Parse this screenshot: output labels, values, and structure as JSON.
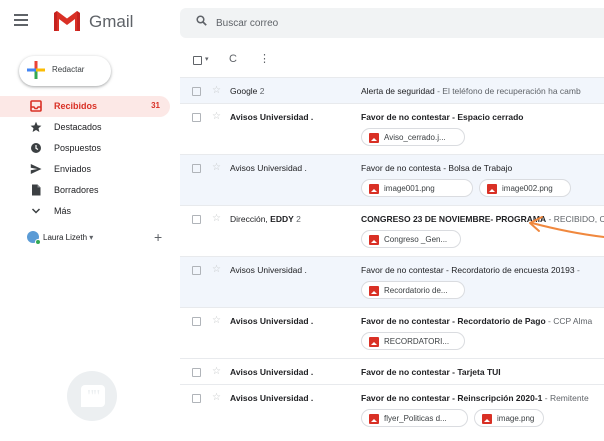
{
  "app": {
    "logo_text": "Gmail",
    "search_placeholder": "Buscar correo",
    "brand_color": "#d93025"
  },
  "sidebar": {
    "compose_label": "Redactar",
    "items": [
      {
        "label": "Recibidos",
        "count": "31",
        "icon": "inbox-icon"
      },
      {
        "label": "Destacados",
        "count": "",
        "icon": "star-icon"
      },
      {
        "label": "Pospuestos",
        "count": "",
        "icon": "clock-icon"
      },
      {
        "label": "Enviados",
        "count": "",
        "icon": "send-icon"
      },
      {
        "label": "Borradores",
        "count": "",
        "icon": "draft-icon"
      },
      {
        "label": "Más",
        "count": "",
        "icon": "chevron-down-icon"
      }
    ],
    "user_name": "Laura Lizeth",
    "user_caret": "▾",
    "user_add": "+"
  },
  "toolbar": {
    "refresh": "C",
    "more": "⋮"
  },
  "emails": [
    {
      "sender": "Google",
      "sender_count": "2",
      "sender_bold": false,
      "read": true,
      "subject": "Alerta de seguridad",
      "snippet": " - El teléfono de recuperación ha camb",
      "subject_bold": false,
      "attachments": []
    },
    {
      "sender": "Avisos Universidad .",
      "sender_count": "",
      "sender_bold": true,
      "read": false,
      "subject": "Favor de no contestar - Espacio cerrado",
      "snippet": "",
      "subject_bold": true,
      "attachments": [
        "Aviso_cerrado.j..."
      ]
    },
    {
      "sender": "Avisos Universidad .",
      "sender_count": "",
      "sender_bold": false,
      "read": true,
      "subject": "Favor de no contesta - Bolsa de Trabajo",
      "snippet": "",
      "subject_bold": false,
      "attachments": [
        "image001.png",
        "image002.png"
      ]
    },
    {
      "sender": "Dirección, EDDY",
      "sender_count": "2",
      "sender_bold": false,
      "read": false,
      "subject": "CONGRESO 23 DE NOVIEMBRE- PROGRAMA",
      "snippet": " - RECIBIDO, C",
      "subject_bold": true,
      "attachments": [
        "Congreso _Gen..."
      ]
    },
    {
      "sender": "Avisos Universidad .",
      "sender_count": "",
      "sender_bold": false,
      "read": true,
      "subject": "Favor de no contestar - Recordatorio de encuesta 20193",
      "snippet": " - ",
      "subject_bold": false,
      "attachments": [
        "Recordatorio de..."
      ]
    },
    {
      "sender": "Avisos Universidad .",
      "sender_count": "",
      "sender_bold": true,
      "read": false,
      "subject": "Favor de no contestar - Recordatorio de Pago",
      "snippet": " - CCP Alma",
      "subject_bold": true,
      "attachments": [
        "RECORDATORI..."
      ]
    },
    {
      "sender": "Avisos Universidad .",
      "sender_count": "",
      "sender_bold": true,
      "read": false,
      "subject": "Favor de no contestar - Tarjeta TUI",
      "snippet": "",
      "subject_bold": true,
      "attachments": []
    },
    {
      "sender": "Avisos Universidad .",
      "sender_count": "",
      "sender_bold": true,
      "read": false,
      "subject": "Favor de no contestar - Reinscripción 2020-1",
      "snippet": " - Remitente",
      "subject_bold": true,
      "attachments": [
        "flyer_Politicas d...",
        "image.png"
      ]
    }
  ],
  "annotation": {
    "arrow_color": "#f0883e"
  }
}
